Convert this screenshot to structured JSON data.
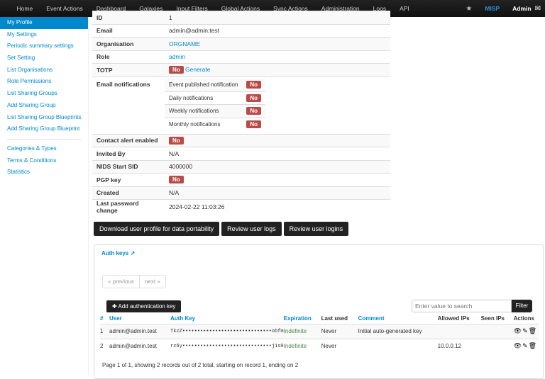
{
  "nav": {
    "items": [
      "Home",
      "Event Actions",
      "Dashboard",
      "Galaxies",
      "Input Filters",
      "Global Actions",
      "Sync Actions",
      "Administration",
      "Logs",
      "API"
    ],
    "brand": "MISP",
    "user": "Admin"
  },
  "sidebar": {
    "items": [
      "My Profile",
      "My Settings",
      "Periodic summary settings",
      "Set Setting",
      "List Organisations",
      "Role Permissions",
      "List Sharing Groups",
      "Add Sharing Group",
      "List Sharing Group Blueprints",
      "Add Sharing Group Blueprint"
    ],
    "items2": [
      "Categories & Types",
      "Terms & Conditions",
      "Statistics"
    ]
  },
  "profile": {
    "id_label": "ID",
    "id": "1",
    "email_label": "Email",
    "email": "admin@admin.test",
    "org_label": "Organisation",
    "org": "ORGNAME",
    "role_label": "Role",
    "role": "admin",
    "totp_label": "TOTP",
    "totp": "No",
    "totp_action": "Generate",
    "notif_label": "Email notifications",
    "notifications": [
      {
        "label": "Event published notification",
        "value": "No"
      },
      {
        "label": "Daily notifications",
        "value": "No"
      },
      {
        "label": "Weekly notifications",
        "value": "No"
      },
      {
        "label": "Monthly notifications",
        "value": "No"
      }
    ],
    "contact_label": "Contact alert enabled",
    "contact": "No",
    "invited_label": "Invited By",
    "invited": "N/A",
    "nids_label": "NIDS Start SID",
    "nids": "4000000",
    "pgp_label": "PGP key",
    "pgp": "No",
    "created_label": "Created",
    "created": "N/A",
    "lastpw_label": "Last password change",
    "lastpw": "2024-02-22 11:03:26"
  },
  "buttons": {
    "download": "Download user profile for data portability",
    "logs": "Review user logs",
    "logins": "Review user logins"
  },
  "authkeys": {
    "title": "Auth keys",
    "prev": "« previous",
    "next": "next »",
    "add": "Add authentication key",
    "search_placeholder": "Enter value to search",
    "filter": "Filter",
    "headers": [
      "#",
      "User",
      "Auth Key",
      "Expiration",
      "Last used",
      "Comment",
      "Allowed IPs",
      "Seen IPs",
      "Actions"
    ],
    "rows": [
      {
        "n": "1",
        "user": "admin@admin.test",
        "key": "TkzZ••••••••••••••••••••••••••••••obfm",
        "exp": "Indefinite",
        "last": "Never",
        "comment": "Initial auto-generated key",
        "ips": "",
        "seen": ""
      },
      {
        "n": "2",
        "user": "admin@admin.test",
        "key": "rz6y••••••••••••••••••••••••••••••j1s0",
        "exp": "Indefinite",
        "last": "Never",
        "comment": "",
        "ips": "10.0.0.12",
        "seen": ""
      }
    ],
    "footer": "Page 1 of 1, showing 2 records out of 2 total, starting on record 1, ending on 2"
  }
}
